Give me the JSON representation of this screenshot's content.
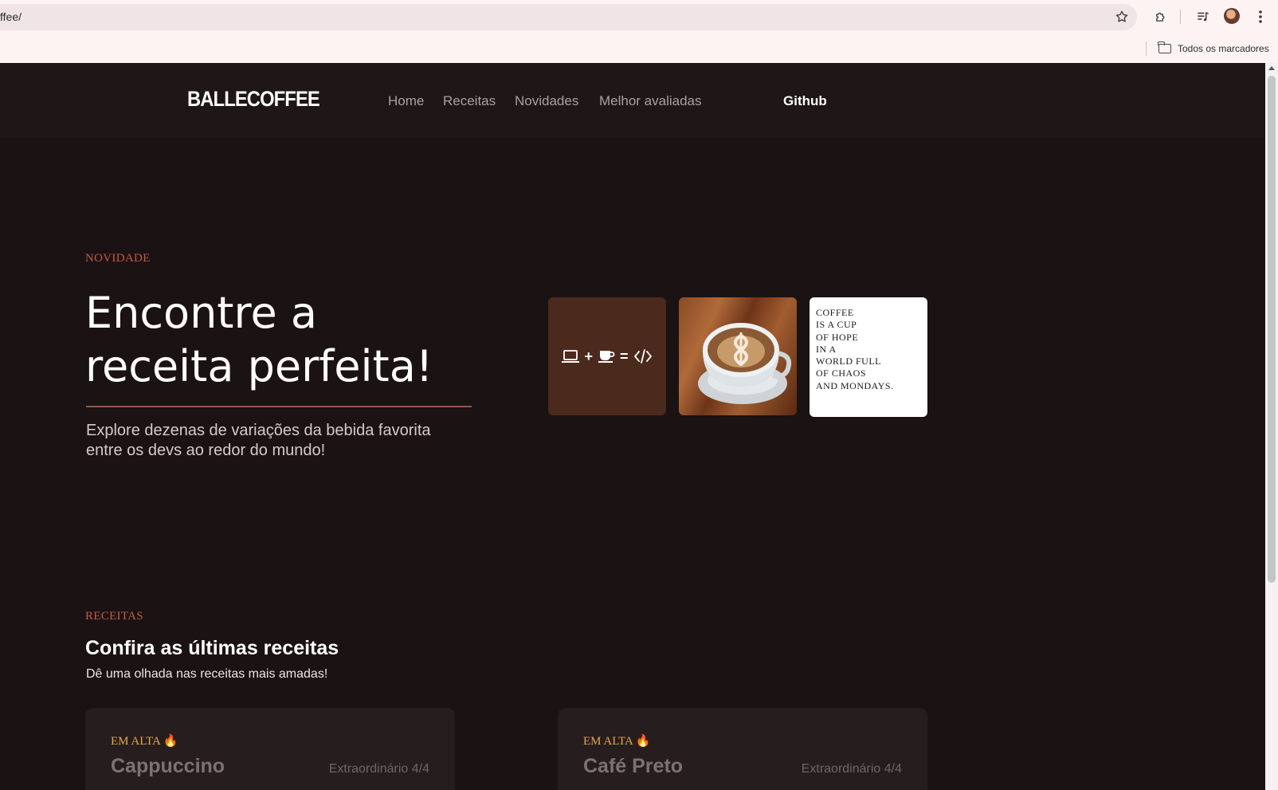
{
  "browser": {
    "url": "ffee/",
    "bookmarks_label": "Todos os marcadores",
    "icons": [
      "star-icon",
      "extensions-icon",
      "media-icon",
      "avatar",
      "kebab-menu-icon"
    ]
  },
  "nav": {
    "logo": "BALLECOFFEE",
    "links": [
      "Home",
      "Receitas",
      "Novidades",
      "Melhor avaliadas"
    ],
    "github": "Github"
  },
  "hero": {
    "eyebrow": "NOVIDADE",
    "title_line1": "Encontre a",
    "title_line2": "receita perfeita!",
    "subtitle_line1": "Explore dezenas de variações da bebida favorita",
    "subtitle_line2": "entre os devs ao redor do mundo!",
    "quote_lines": [
      "COFFEE",
      "IS A CUP",
      "OF HOPE",
      "IN A",
      "WORLD FULL",
      "OF CHAOS",
      "AND MONDAYS."
    ],
    "dev_symbols": [
      "laptop-icon",
      "+",
      "coffee-cup-icon",
      "=",
      "code-icon"
    ]
  },
  "recipes": {
    "eyebrow": "RECEITAS",
    "title": "Confira as últimas receitas",
    "subtitle": "Dê uma olhada nas receitas mais amadas!",
    "cards": [
      {
        "badge": "EM ALTA 🔥",
        "title": "Cappuccino",
        "rating": "Extraordinário 4/4"
      },
      {
        "badge": "EM ALTA 🔥",
        "title": "Café Preto",
        "rating": "Extraordinário 4/4"
      }
    ]
  },
  "colors": {
    "page_bg": "#1b1213",
    "nav_bg": "#1e1617",
    "accent_red": "#c55a46",
    "accent_gold": "#e7a64a",
    "card_bg": "#261d1e",
    "dev_tile_bg": "#4b2a1d"
  }
}
